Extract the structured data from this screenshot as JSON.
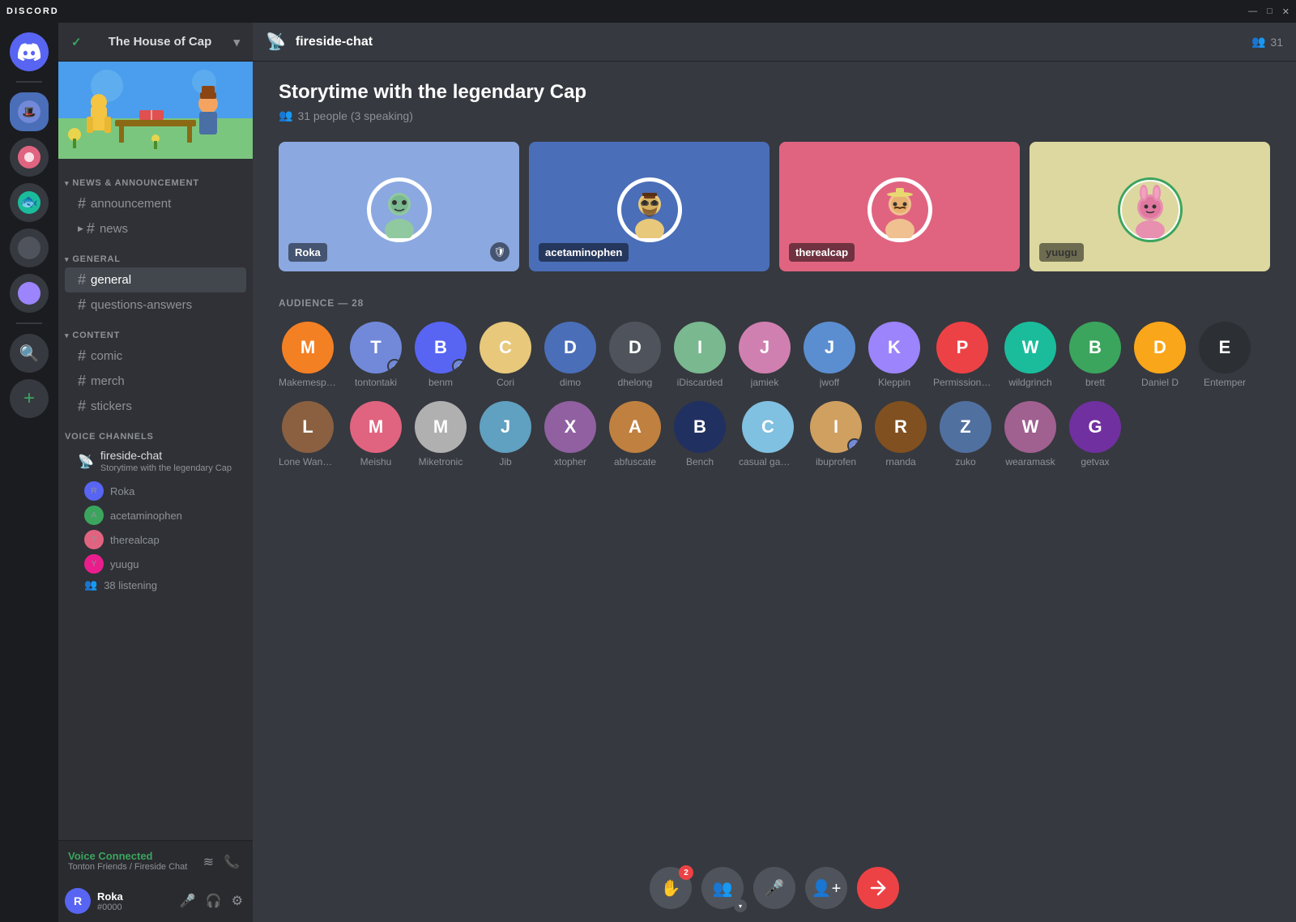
{
  "app": {
    "title": "DISCORD",
    "window_controls": [
      "—",
      "□",
      "✕"
    ]
  },
  "server": {
    "name": "The House of Cap",
    "check_icon": "✓",
    "dropdown_icon": "▾"
  },
  "channel_groups": [
    {
      "name": "NEWS & ANNOUNCEMENT",
      "channels": [
        "announcement",
        "news"
      ]
    },
    {
      "name": "GENERAL",
      "channels": [
        "general",
        "questions-answers"
      ]
    },
    {
      "name": "CONTENT",
      "channels": [
        "comic",
        "merch",
        "stickers"
      ]
    }
  ],
  "voice_section": {
    "label": "VOICE CHANNELS",
    "active_channel": "fireside-chat",
    "active_subtitle": "Storytime with the legendary Cap",
    "speakers": [
      {
        "name": "Roka",
        "color": "av-blue"
      },
      {
        "name": "acetaminophen",
        "color": "av-green"
      },
      {
        "name": "therealcap",
        "color": "av-orange"
      },
      {
        "name": "yuugu",
        "color": "av-pink"
      }
    ],
    "listening_count": "38 listening"
  },
  "voice_connected": {
    "status": "Voice Connected",
    "location": "Tonton Friends / Fireside Chat"
  },
  "user": {
    "name": "Roka",
    "tag": "#0000",
    "avatar_letter": "R",
    "avatar_color": "av-blue"
  },
  "channel_header": {
    "icon": "📡",
    "name": "fireside-chat",
    "members_icon": "👥",
    "members_count": "31"
  },
  "stage": {
    "title": "Storytime with the legendary Cap",
    "people_count": "31 people (3 speaking)",
    "speakers": [
      {
        "name": "Roka",
        "card_class": "speaker-card-blue",
        "has_mod": true
      },
      {
        "name": "acetaminophen",
        "card_class": "speaker-card-dark-blue",
        "has_mod": false
      },
      {
        "name": "therealcap",
        "card_class": "speaker-card-pink",
        "has_mod": false
      },
      {
        "name": "yuugu",
        "card_class": "speaker-card-cream",
        "has_mod": false
      }
    ],
    "audience_label": "AUDIENCE — 28",
    "audience": [
      {
        "name": "Makemespeakrr",
        "color": "av-yellow"
      },
      {
        "name": "tontontaki",
        "color": "av-teal",
        "badge": true
      },
      {
        "name": "benm",
        "color": "av-blue",
        "badge": true
      },
      {
        "name": "Cori",
        "color": "av-orange"
      },
      {
        "name": "dimo",
        "color": "av-purple"
      },
      {
        "name": "dhelong",
        "color": "av-dark"
      },
      {
        "name": "iDiscarded",
        "color": "av-green"
      },
      {
        "name": "jamiek",
        "color": "av-dark"
      },
      {
        "name": "jwoff",
        "color": "av-dark"
      },
      {
        "name": "Kleppin",
        "color": "av-purple"
      },
      {
        "name": "Permission Man",
        "color": "av-blue"
      },
      {
        "name": "wildgrinch",
        "color": "av-red"
      },
      {
        "name": "brett",
        "color": "av-blue"
      },
      {
        "name": "Daniel D",
        "color": "av-dark"
      },
      {
        "name": "Entemper",
        "color": "av-purple"
      },
      {
        "name": "Lone Wanderer",
        "color": "av-pink"
      },
      {
        "name": "Meishu",
        "color": "av-pink"
      },
      {
        "name": "Miketronic",
        "color": "av-dark"
      },
      {
        "name": "Jib",
        "color": "av-yellow"
      },
      {
        "name": "xtopher",
        "color": "av-dark"
      },
      {
        "name": "abfuscate",
        "color": "av-dark"
      },
      {
        "name": "Bench",
        "color": "av-dark"
      },
      {
        "name": "casual gamer",
        "color": "av-blue"
      },
      {
        "name": "ibuprofen",
        "color": "av-teal",
        "badge": true
      },
      {
        "name": "rnanda",
        "color": "av-orange"
      },
      {
        "name": "zuko",
        "color": "av-dark"
      },
      {
        "name": "wearamask",
        "color": "av-blue"
      },
      {
        "name": "getvax",
        "color": "av-dark"
      }
    ]
  },
  "stage_controls": [
    {
      "icon": "✋",
      "badge": "2",
      "label": "raise-hand"
    },
    {
      "icon": "👥",
      "dropdown": true,
      "label": "invite"
    },
    {
      "icon": "🎤",
      "label": "microphone"
    },
    {
      "icon": "👤",
      "label": "add-speaker"
    },
    {
      "icon": "→",
      "label": "leave",
      "red": true
    }
  ]
}
